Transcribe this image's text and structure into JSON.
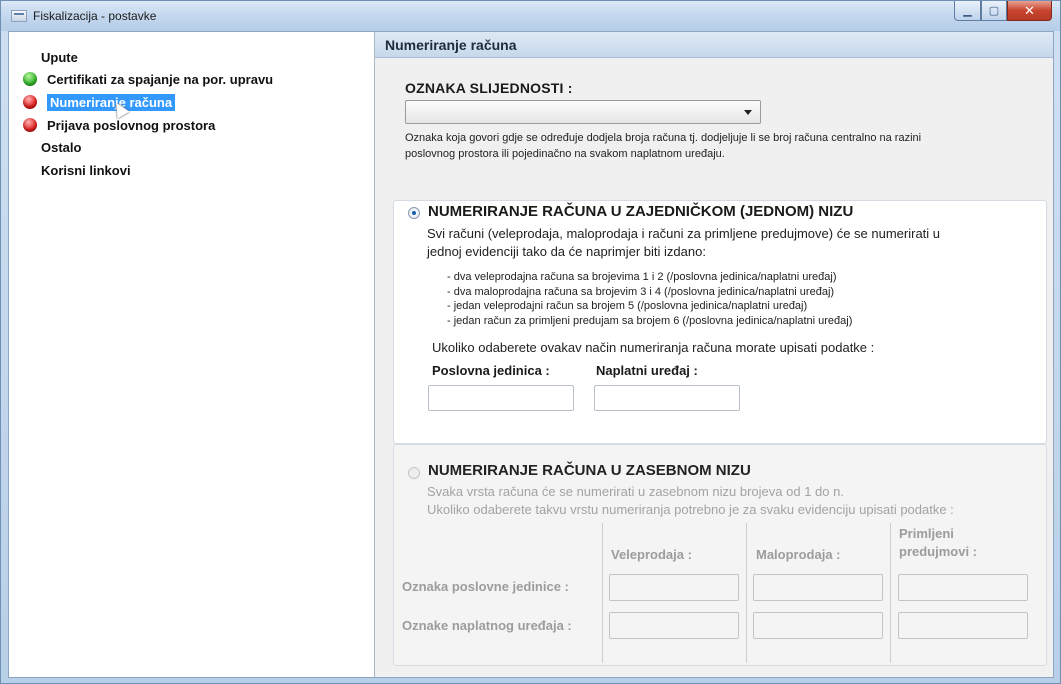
{
  "window": {
    "title": "Fiskalizacija - postavke",
    "minimize_symbol": "▁",
    "maximize_symbol": "▢",
    "close_symbol": "✕"
  },
  "tree": {
    "items": [
      {
        "label": "Upute",
        "status": "none"
      },
      {
        "label": "Certifikati za spajanje na por. upravu",
        "status": "green"
      },
      {
        "label": "Numeriranje računa",
        "status": "red",
        "selected": true
      },
      {
        "label": "Prijava poslovnog prostora",
        "status": "red"
      },
      {
        "label": "Ostalo",
        "status": "none"
      },
      {
        "label": "Korisni linkovi",
        "status": "none"
      }
    ]
  },
  "panel": {
    "header": "Numeriranje računa",
    "sequence_label": "OZNAKA SLIJEDNOSTI :",
    "sequence_value": "",
    "description_line1": "Oznaka koja govori gdje se određuje dodjela broja računa tj. dodjeljuje li se broj računa centralno na razini",
    "description_line2": "poslovnog prostora ili pojedinačno na svakom naplatnom uređaju."
  },
  "single_sequence": {
    "selected": true,
    "title": "NUMERIRANJE RAČUNA U ZAJEDNIČKOM (JEDNOM) NIZU",
    "text_line1": "Svi računi (veleprodaja, maloprodaja i računi za primljene predujmove) će se numerirati u",
    "text_line2": "jednoj evidenciji tako da će naprimjer biti izdano:",
    "bullets": [
      "- dva veleprodajna računa sa brojevima 1 i 2 (/poslovna jedinica/naplatni uređaj)",
      "- dva maloprodajna računa sa brojevim 3 i 4 (/poslovna jedinica/naplatni uređaj)",
      "- jedan veleprodajni račun sa brojem 5 (/poslovna jedinica/naplatni uređaj)",
      "- jedan račun za primljeni predujam sa brojem 6 (/poslovna jedinica/naplatni uređaj)"
    ],
    "instruction": "Ukoliko odaberete ovakav način numeriranja računa morate upisati podatke :",
    "business_unit_label": "Poslovna jedinica :",
    "device_label": "Naplatni uređaj :",
    "business_unit_value": "",
    "device_value": ""
  },
  "separate_sequence": {
    "selected": false,
    "title": "NUMERIRANJE RAČUNA U ZASEBNOM NIZU",
    "text_line1": "Svaka vrsta računa će se numerirati u zasebnom nizu brojeva od 1 do n.",
    "text_line2": "Ukoliko odaberete takvu vrstu numeriranja potrebno je za svaku evidenciju upisati podatke :",
    "col_wholesale": "Veleprodaja :",
    "col_retail": "Maloprodaja :",
    "col_advance_line1": "Primljeni",
    "col_advance_line2": "predujmovi :",
    "row_unit_label": "Oznaka poslovne jedinice   :",
    "row_device_label": "Oznake naplatnog uređaja  :"
  }
}
